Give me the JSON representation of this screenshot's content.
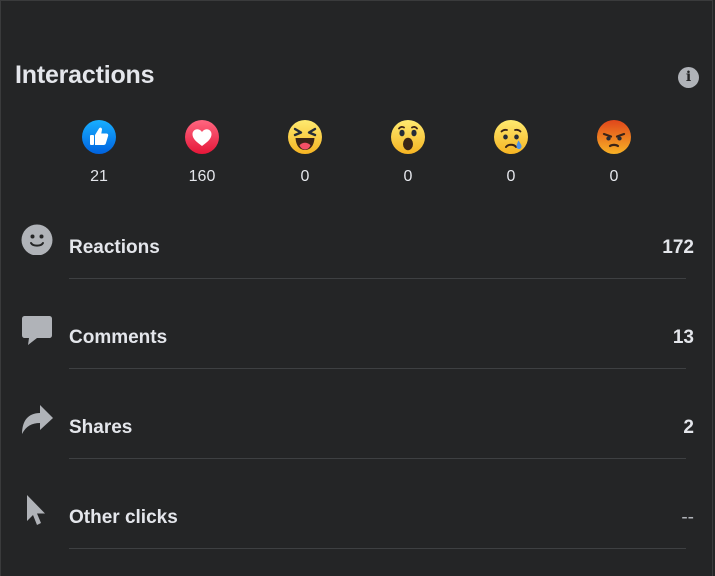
{
  "header": {
    "title": "Interactions",
    "info_icon": "info-icon"
  },
  "reactions": [
    {
      "icon": "like-icon",
      "count": "21",
      "color": "#1877f2"
    },
    {
      "icon": "love-icon",
      "count": "160",
      "color": "#f33e58"
    },
    {
      "icon": "haha-icon",
      "count": "0",
      "color": "#f7b125"
    },
    {
      "icon": "wow-icon",
      "count": "0",
      "color": "#f7b125"
    },
    {
      "icon": "sad-icon",
      "count": "0",
      "color": "#f7b125"
    },
    {
      "icon": "angry-icon",
      "count": "0",
      "color": "#e9710f"
    }
  ],
  "metrics": [
    {
      "icon": "smiley-icon",
      "label": "Reactions",
      "value": "172"
    },
    {
      "icon": "comment-icon",
      "label": "Comments",
      "value": "13"
    },
    {
      "icon": "share-icon",
      "label": "Shares",
      "value": "2"
    },
    {
      "icon": "cursor-icon",
      "label": "Other clicks",
      "value": "--"
    }
  ]
}
